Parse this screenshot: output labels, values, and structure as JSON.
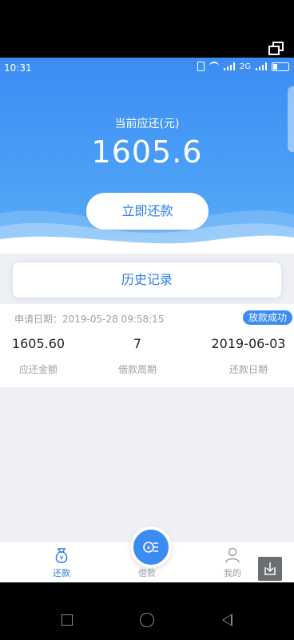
{
  "statusbar": {
    "time": "10:31",
    "network": "2G"
  },
  "hero": {
    "label": "当前应还(元)",
    "amount": "1605.6",
    "repay_button": "立即还款"
  },
  "history_button": "历史记录",
  "record": {
    "apply_text": "申请日期：2019-05-28 09:58:15",
    "status": "放款成功",
    "columns": [
      {
        "value": "1605.60",
        "label": "应还金额"
      },
      {
        "value": "7",
        "label": "借款周期"
      },
      {
        "value": "2019-06-03",
        "label": "还款日期"
      }
    ]
  },
  "tabs": {
    "repay": "还款",
    "borrow": "借款",
    "mine": "我的"
  },
  "colors": {
    "accent": "#3b8cf2",
    "hero_top": "#3c8cf3",
    "muted": "#9aa0a8"
  }
}
